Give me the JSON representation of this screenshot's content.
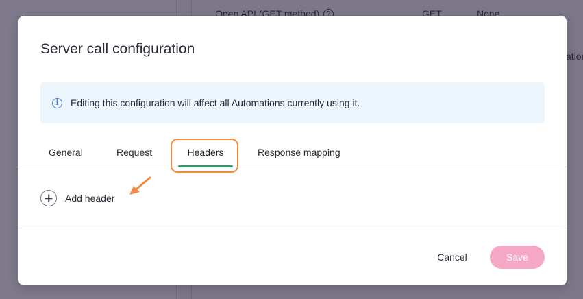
{
  "background": {
    "row_name": "Open API (GET method)",
    "row_method": "GET",
    "row_auth": "None",
    "truncated_text": "ation"
  },
  "modal": {
    "title": "Server call configuration",
    "info_text": "Editing this configuration will affect all Automations currently using it.",
    "tabs": [
      {
        "label": "General"
      },
      {
        "label": "Request"
      },
      {
        "label": "Headers",
        "active": true
      },
      {
        "label": "Response mapping"
      }
    ],
    "add_header_label": "Add header",
    "cancel_label": "Cancel",
    "save_label": "Save"
  },
  "colors": {
    "accent_tab_underline": "#2f9a6a",
    "highlight_annotation": "#f28a45",
    "save_disabled": "#f5a8c6",
    "info_banner_bg": "#edf5fd",
    "info_icon": "#3d7ad6"
  },
  "icons": [
    "info-icon",
    "plus-circle-icon",
    "help-icon",
    "annotation-arrow-icon"
  ]
}
